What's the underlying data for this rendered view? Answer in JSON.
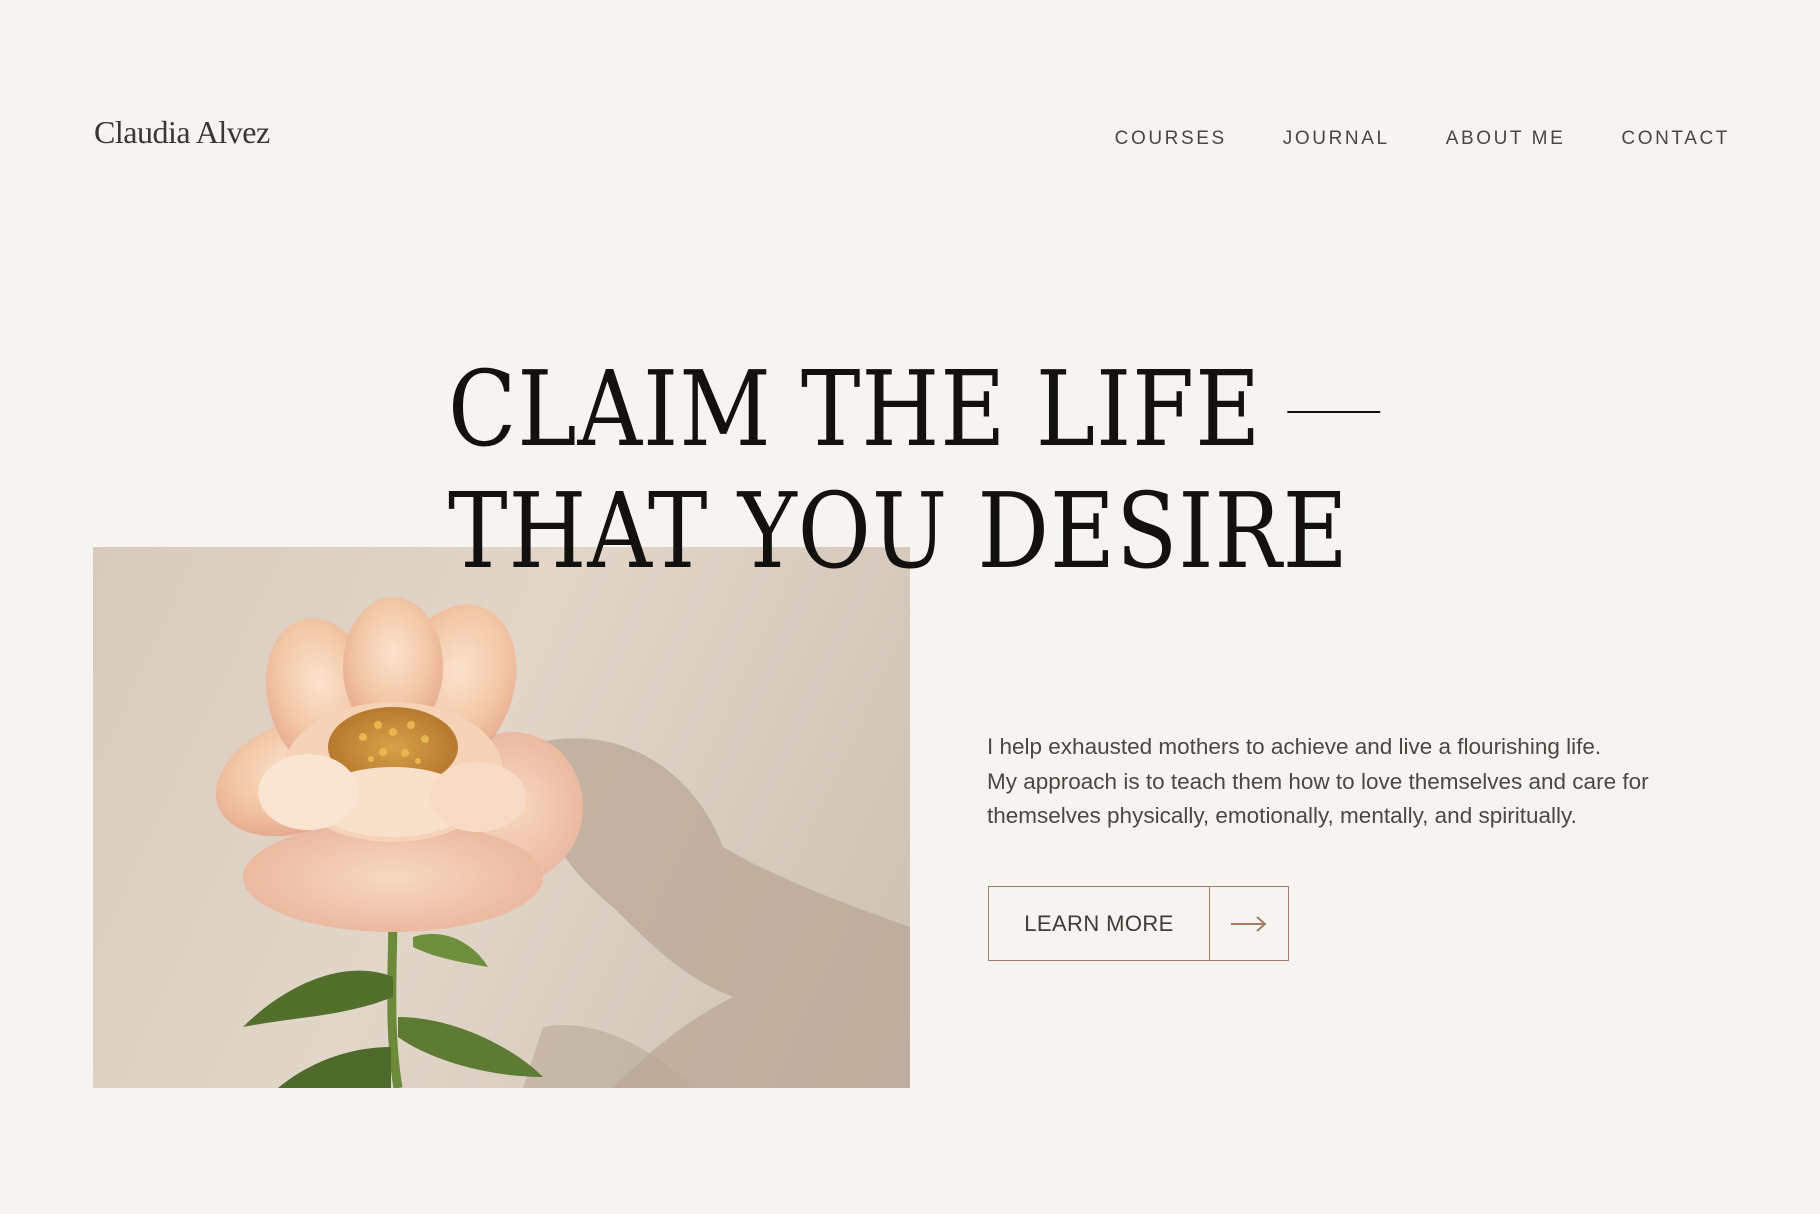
{
  "header": {
    "logo_text": "Claudia Alvez",
    "nav": [
      {
        "label": "COURSES"
      },
      {
        "label": "JOURNAL"
      },
      {
        "label": "ABOUT ME"
      },
      {
        "label": "CONTACT"
      }
    ]
  },
  "hero": {
    "headline_line1": "CLAIM THE LIFE",
    "headline_line2": "THAT YOU DESIRE",
    "intro_lines": [
      "I help exhausted mothers to achieve and live a flourishing life.",
      "My approach is to teach them how to love themselves and care for",
      "themselves physically, emotionally, mentally, and spiritually."
    ],
    "cta_label": "LEARN MORE",
    "cta_icon": "arrow-right-icon",
    "image": "peony-flower-photo"
  },
  "colors": {
    "background": "#f5f4f1",
    "text_dark": "#121110",
    "accent": "#a37d64"
  }
}
